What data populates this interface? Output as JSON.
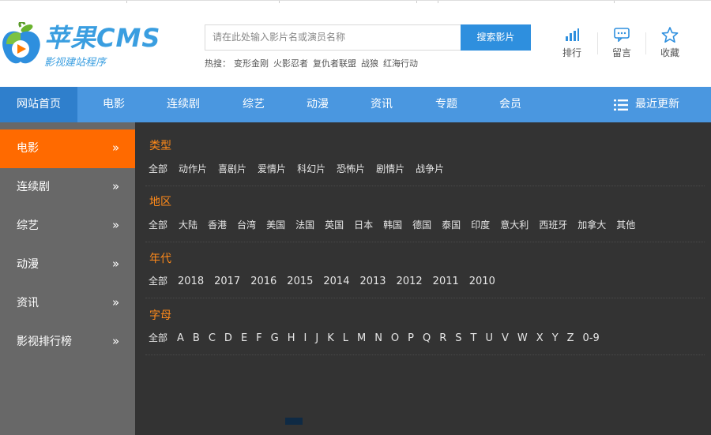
{
  "logo": {
    "title": "苹果CMS",
    "subtitle": "影视建站程序"
  },
  "search": {
    "placeholder": "请在此处输入影片名或演员名称",
    "button_label": "搜索影片",
    "hot_label": "热搜：",
    "hot_terms": [
      "变形金刚",
      "火影忍者",
      "复仇者联盟",
      "战狼",
      "红海行动"
    ]
  },
  "header_tools": [
    {
      "label": "排行",
      "icon": "bar-chart-icon"
    },
    {
      "label": "留言",
      "icon": "message-icon"
    },
    {
      "label": "收藏",
      "icon": "star-icon"
    }
  ],
  "nav": {
    "items": [
      "网站首页",
      "电影",
      "连续剧",
      "综艺",
      "动漫",
      "资讯",
      "专题",
      "会员"
    ],
    "active_index": 0,
    "recent_label": "最近更新",
    "recent_icon": "list-icon"
  },
  "sidebar": {
    "items": [
      "电影",
      "连续剧",
      "综艺",
      "动漫",
      "资讯",
      "影视排行榜"
    ],
    "arrow": "»",
    "active_index": 0
  },
  "filters": [
    {
      "title": "类型",
      "options": [
        "全部",
        "动作片",
        "喜剧片",
        "爱情片",
        "科幻片",
        "恐怖片",
        "剧情片",
        "战争片"
      ]
    },
    {
      "title": "地区",
      "options": [
        "全部",
        "大陆",
        "香港",
        "台湾",
        "美国",
        "法国",
        "英国",
        "日本",
        "韩国",
        "德国",
        "泰国",
        "印度",
        "意大利",
        "西班牙",
        "加拿大",
        "其他"
      ]
    },
    {
      "title": "年代",
      "options": [
        "全部",
        "2018",
        "2017",
        "2016",
        "2015",
        "2014",
        "2013",
        "2012",
        "2011",
        "2010"
      ]
    },
    {
      "title": "字母",
      "options": [
        "全部",
        "A",
        "B",
        "C",
        "D",
        "E",
        "F",
        "G",
        "H",
        "I",
        "J",
        "K",
        "L",
        "M",
        "N",
        "O",
        "P",
        "Q",
        "R",
        "S",
        "T",
        "U",
        "V",
        "W",
        "X",
        "Y",
        "Z",
        "0-9"
      ]
    }
  ],
  "colors": {
    "brand_blue": "#4a97e0",
    "accent_orange": "#ff6a00",
    "panel_bg": "#333333",
    "sidebar_bg": "#686868"
  }
}
